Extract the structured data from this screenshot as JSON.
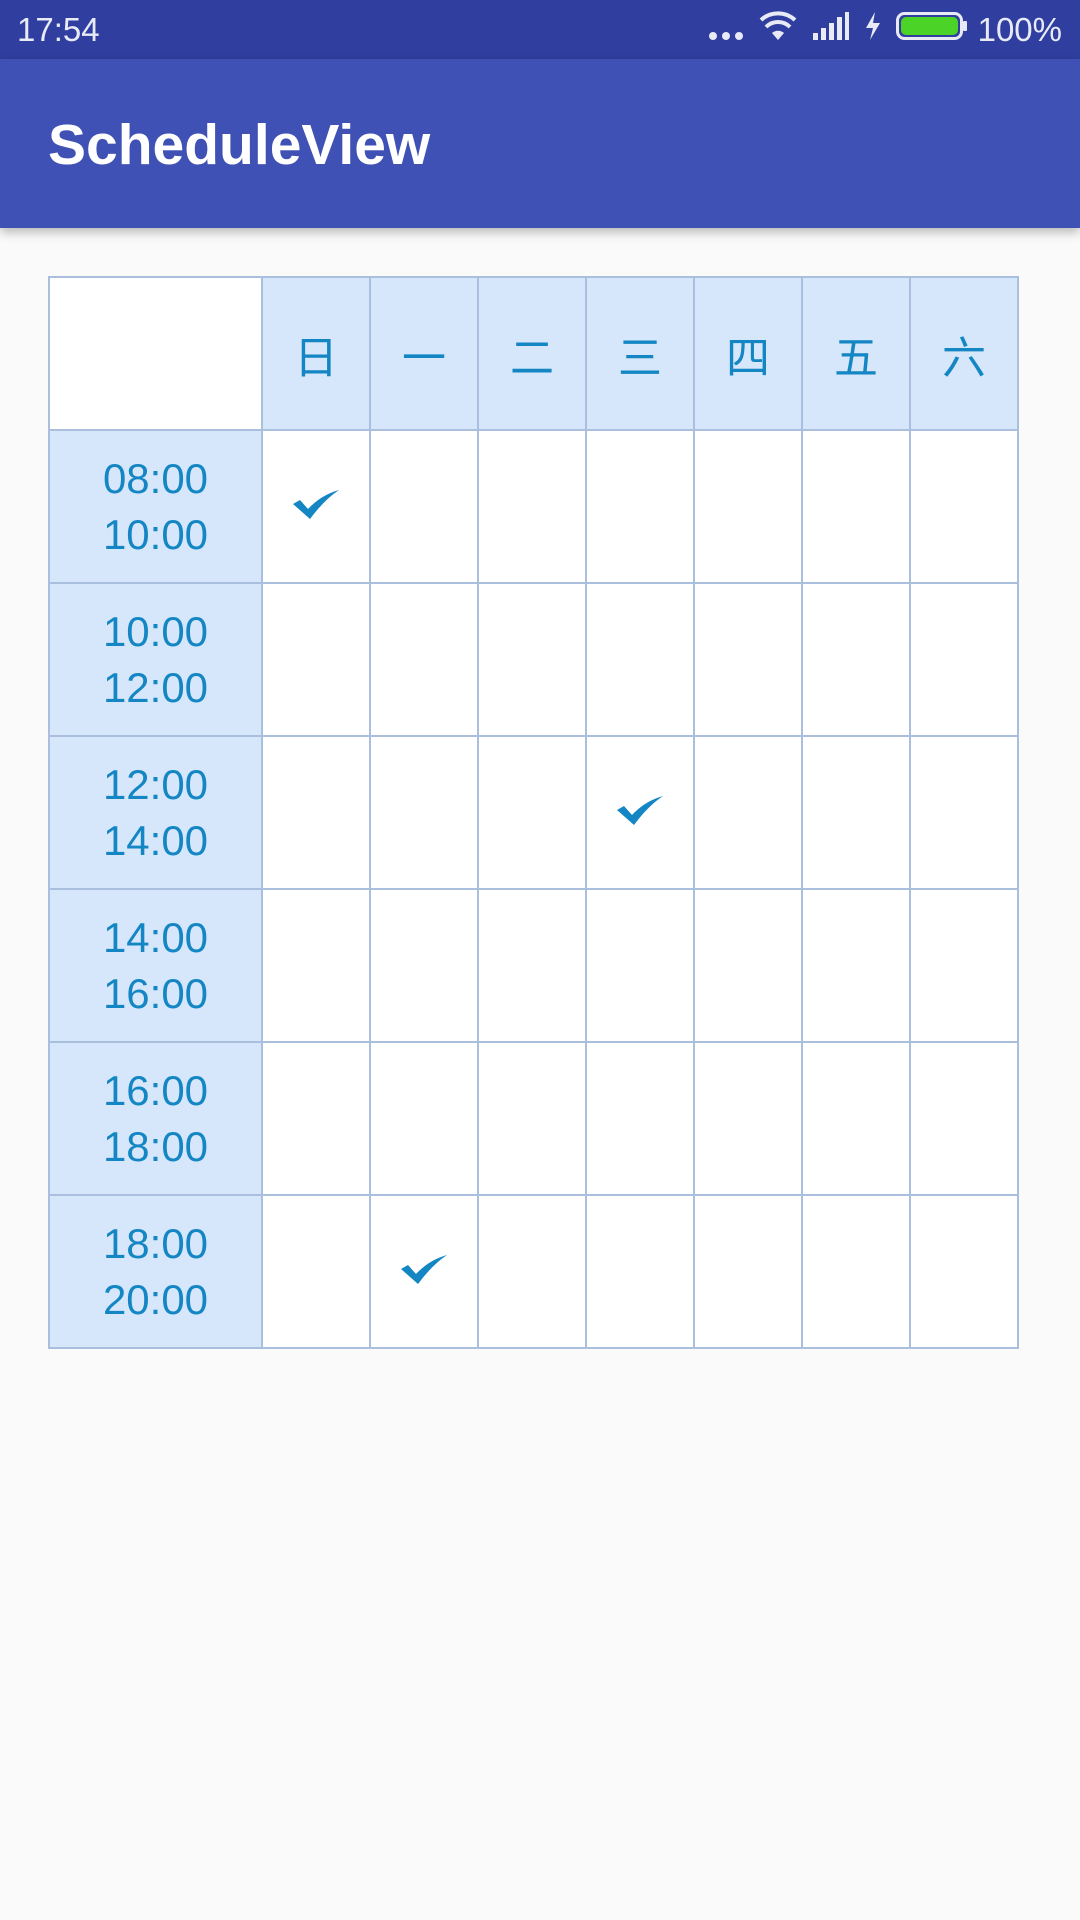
{
  "status_bar": {
    "time": "17:54",
    "battery": "100%",
    "icons": [
      "more-dots-icon",
      "wifi-icon",
      "cell-signal-icon",
      "charging-bolt-icon",
      "battery-icon"
    ]
  },
  "app_bar": {
    "title": "ScheduleView"
  },
  "schedule": {
    "days": [
      "日",
      "一",
      "二",
      "三",
      "四",
      "五",
      "六"
    ],
    "slots": [
      {
        "start": "08:00",
        "end": "10:00"
      },
      {
        "start": "10:00",
        "end": "12:00"
      },
      {
        "start": "12:00",
        "end": "14:00"
      },
      {
        "start": "14:00",
        "end": "16:00"
      },
      {
        "start": "16:00",
        "end": "18:00"
      },
      {
        "start": "18:00",
        "end": "20:00"
      }
    ],
    "checked": [
      {
        "slot": 0,
        "day": 0
      },
      {
        "slot": 2,
        "day": 3
      },
      {
        "slot": 5,
        "day": 1
      }
    ],
    "check_icon": "checkmark-icon",
    "colors": {
      "accent_text": "#1386c3",
      "header_bg": "#d6e7fb",
      "grid_line": "#a9bfdd",
      "status_bar": "#303f9f",
      "app_bar": "#3f51b5"
    }
  }
}
